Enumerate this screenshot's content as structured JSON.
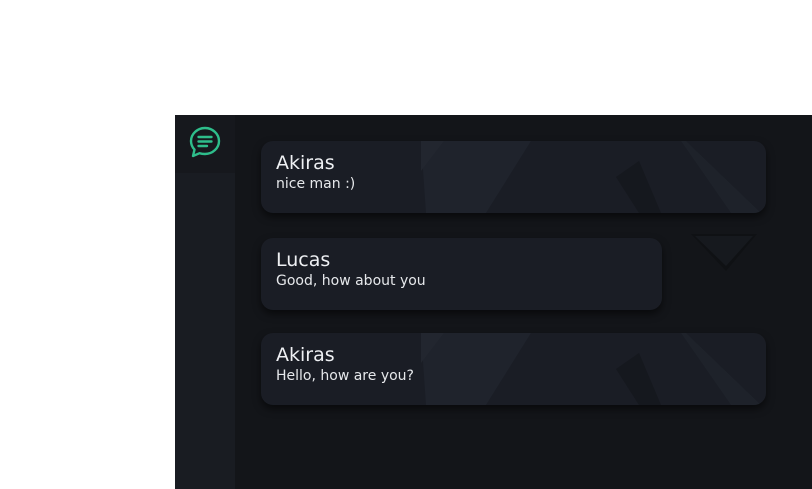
{
  "sidebar": {
    "icon": "chat-bubble-icon",
    "accent_color": "#2ebd8b"
  },
  "messages": [
    {
      "author": "Akiras",
      "text": "nice man :)"
    },
    {
      "author": "Lucas",
      "text": "Good, how about you"
    },
    {
      "author": "Akiras",
      "text": "Hello, how are you?"
    }
  ],
  "controls": {
    "scroll_icon": "chevron-down-icon"
  }
}
